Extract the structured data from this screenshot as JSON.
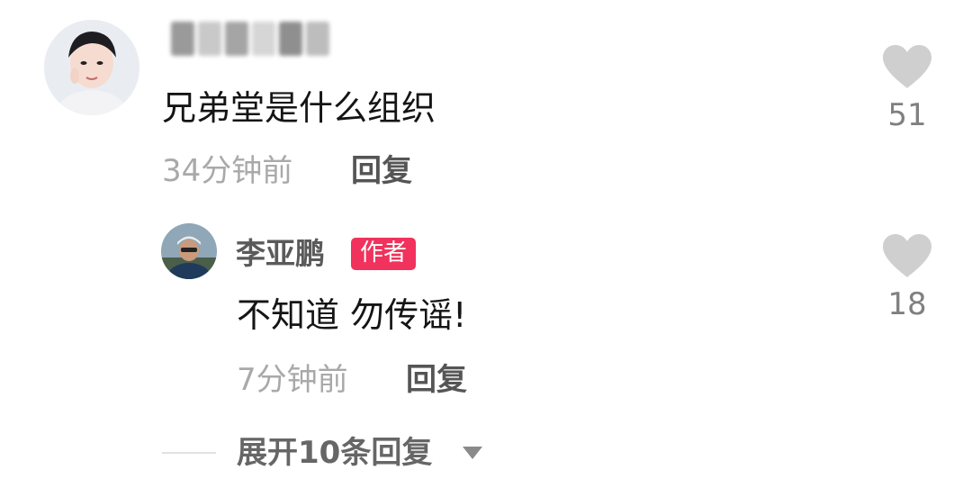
{
  "comment": {
    "username_redacted": true,
    "text": "兄弟堂是什么组织",
    "time": "34分钟前",
    "reply_label": "回复",
    "like_count": "51"
  },
  "reply": {
    "author_name": "李亚鹏",
    "author_badge": "作者",
    "text": "不知道 勿传谣!",
    "time": "7分钟前",
    "reply_label": "回复",
    "like_count": "18"
  },
  "expand": {
    "label": "展开10条回复",
    "icon": "chevron-down-icon"
  },
  "colors": {
    "badge_bg": "#f0325c",
    "heart": "#cfcfcf",
    "muted_text": "#a9a9a9"
  }
}
